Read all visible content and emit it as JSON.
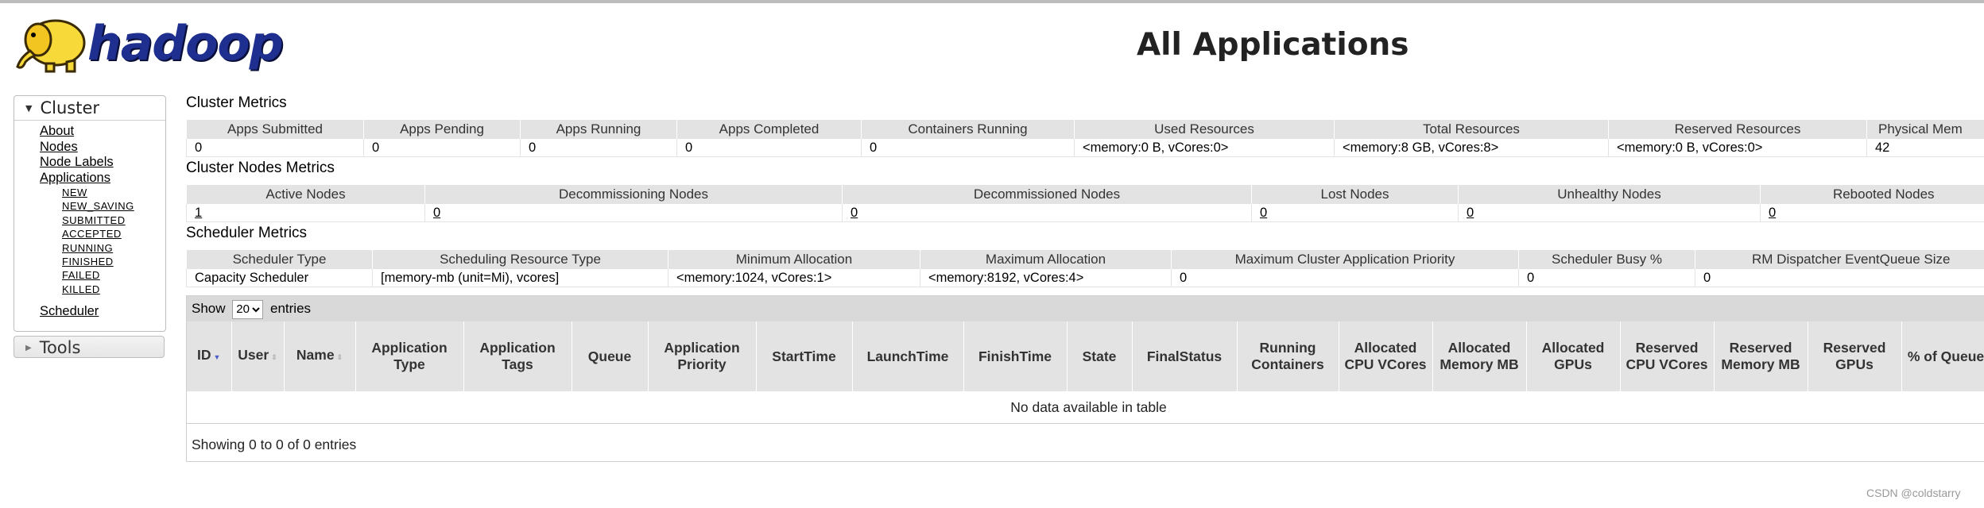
{
  "header": {
    "logo_alt": "hadoop",
    "page_title": "All Applications"
  },
  "sidebar": {
    "cluster_label": "Cluster",
    "links": [
      "About",
      "Nodes",
      "Node Labels",
      "Applications"
    ],
    "app_states": [
      "NEW",
      "NEW_SAVING",
      "SUBMITTED",
      "ACCEPTED",
      "RUNNING",
      "FINISHED",
      "FAILED",
      "KILLED"
    ],
    "scheduler": "Scheduler",
    "tools_label": "Tools"
  },
  "cluster_metrics": {
    "title": "Cluster Metrics",
    "headers": [
      "Apps Submitted",
      "Apps Pending",
      "Apps Running",
      "Apps Completed",
      "Containers Running",
      "Used Resources",
      "Total Resources",
      "Reserved Resources",
      "Physical Mem"
    ],
    "values": [
      "0",
      "0",
      "0",
      "0",
      "0",
      "<memory:0 B, vCores:0>",
      "<memory:8 GB, vCores:8>",
      "<memory:0 B, vCores:0>",
      "42"
    ]
  },
  "node_metrics": {
    "title": "Cluster Nodes Metrics",
    "headers": [
      "Active Nodes",
      "Decommissioning Nodes",
      "Decommissioned Nodes",
      "Lost Nodes",
      "Unhealthy Nodes",
      "Rebooted Nodes"
    ],
    "values": [
      "1",
      "0",
      "0",
      "0",
      "0",
      "0"
    ]
  },
  "scheduler_metrics": {
    "title": "Scheduler Metrics",
    "headers": [
      "Scheduler Type",
      "Scheduling Resource Type",
      "Minimum Allocation",
      "Maximum Allocation",
      "Maximum Cluster Application Priority",
      "Scheduler Busy %",
      "RM Dispatcher EventQueue Size"
    ],
    "values": [
      "Capacity Scheduler",
      "[memory-mb (unit=Mi), vcores]",
      "<memory:1024, vCores:1>",
      "<memory:8192, vCores:4>",
      "0",
      "0",
      "0"
    ]
  },
  "apps": {
    "show_label": "Show",
    "entries_value": "20",
    "entries_label": "entries",
    "columns": [
      "ID",
      "User",
      "Name",
      "Application Type",
      "Application Tags",
      "Queue",
      "Application Priority",
      "StartTime",
      "LaunchTime",
      "FinishTime",
      "State",
      "FinalStatus",
      "Running Containers",
      "Allocated CPU VCores",
      "Allocated Memory MB",
      "Allocated GPUs",
      "Reserved CPU VCores",
      "Reserved Memory MB",
      "Reserved GPUs",
      "% of Queue"
    ],
    "no_data": "No data available in table",
    "footer": "Showing 0 to 0 of 0 entries"
  },
  "watermark": "CSDN @coldstarry"
}
